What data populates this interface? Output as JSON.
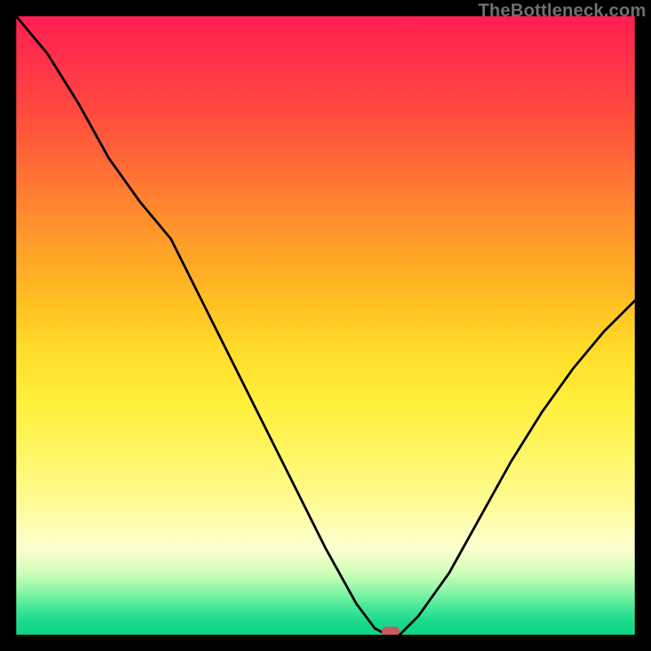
{
  "watermark": "TheBottleneck.com",
  "chart_data": {
    "type": "line",
    "title": "",
    "xlabel": "",
    "ylabel": "",
    "x": [
      0.0,
      0.05,
      0.1,
      0.15,
      0.2,
      0.25,
      0.3,
      0.35,
      0.4,
      0.45,
      0.5,
      0.55,
      0.58,
      0.6,
      0.62,
      0.65,
      0.7,
      0.75,
      0.8,
      0.85,
      0.9,
      0.95,
      1.0
    ],
    "values": [
      1.0,
      0.94,
      0.86,
      0.77,
      0.7,
      0.64,
      0.54,
      0.44,
      0.34,
      0.24,
      0.14,
      0.05,
      0.01,
      0.0,
      0.0,
      0.03,
      0.1,
      0.19,
      0.28,
      0.36,
      0.43,
      0.49,
      0.54
    ],
    "xlim": [
      0,
      1
    ],
    "ylim": [
      0,
      1
    ],
    "marker": {
      "x": 0.605,
      "y": 0.0
    },
    "colors": {
      "curve": "#000000",
      "marker": "#c65a5f",
      "gradient_top": "#ff1f52",
      "gradient_bottom": "#0fd486",
      "frame": "#000000"
    }
  }
}
